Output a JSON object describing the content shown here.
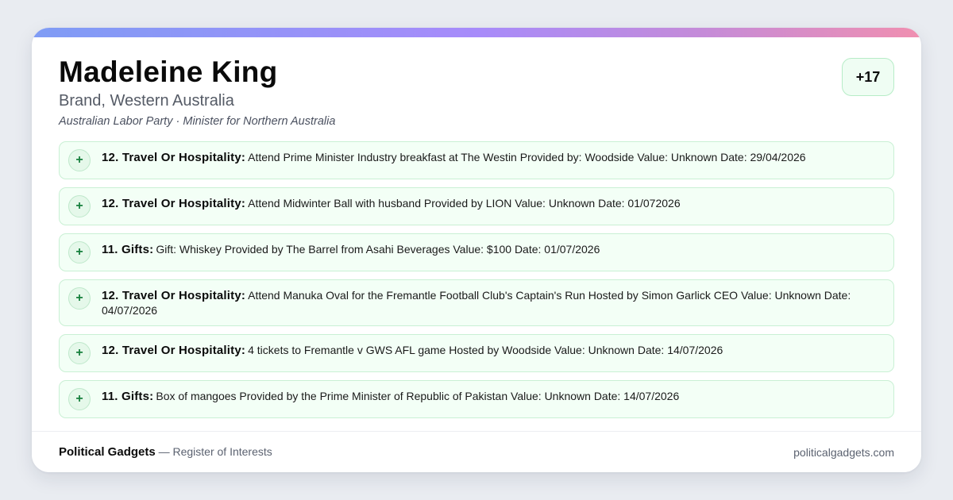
{
  "header": {
    "name": "Madeleine King",
    "electorate": "Brand, Western Australia",
    "party": "Australian Labor Party",
    "separator": "·",
    "role": "Minister for Northern Australia",
    "count_badge": "+17"
  },
  "entries": [
    {
      "icon": "plus-icon",
      "category": "12. Travel Or Hospitality:",
      "text": "Attend Prime Minister Industry breakfast at The Westin Provided by: Woodside Value: Unknown Date: 29/04/2026"
    },
    {
      "icon": "plus-icon",
      "category": "12. Travel Or Hospitality:",
      "text": "Attend Midwinter Ball with husband Provided by LION Value: Unknown Date: 01/072026"
    },
    {
      "icon": "plus-icon",
      "category": "11. Gifts:",
      "text": "Gift: Whiskey Provided by The Barrel from Asahi Beverages Value: $100 Date: 01/07/2026"
    },
    {
      "icon": "plus-icon",
      "category": "12. Travel Or Hospitality:",
      "text": "Attend Manuka Oval for the Fremantle Football Club's Captain's Run Hosted by Simon Garlick CEO Value: Unknown Date: 04/07/2026"
    },
    {
      "icon": "plus-icon",
      "category": "12. Travel Or Hospitality:",
      "text": "4 tickets to Fremantle v GWS AFL game Hosted by Woodside Value: Unknown Date: 14/07/2026"
    },
    {
      "icon": "plus-icon",
      "category": "11. Gifts:",
      "text": "Box of mangoes Provided by the Prime Minister of Republic of Pakistan Value: Unknown Date: 14/07/2026"
    }
  ],
  "footer": {
    "brand": "Political Gadgets",
    "tagline": " — Register of Interests",
    "domain": "politicalgadgets.com"
  },
  "colors": {
    "accent_gradient": [
      "#7f9cf5",
      "#a78bfa",
      "#f08fb0"
    ],
    "entry_background": "#f3fff6",
    "entry_border": "#c9f0d4",
    "plus_icon": "#17803d"
  }
}
